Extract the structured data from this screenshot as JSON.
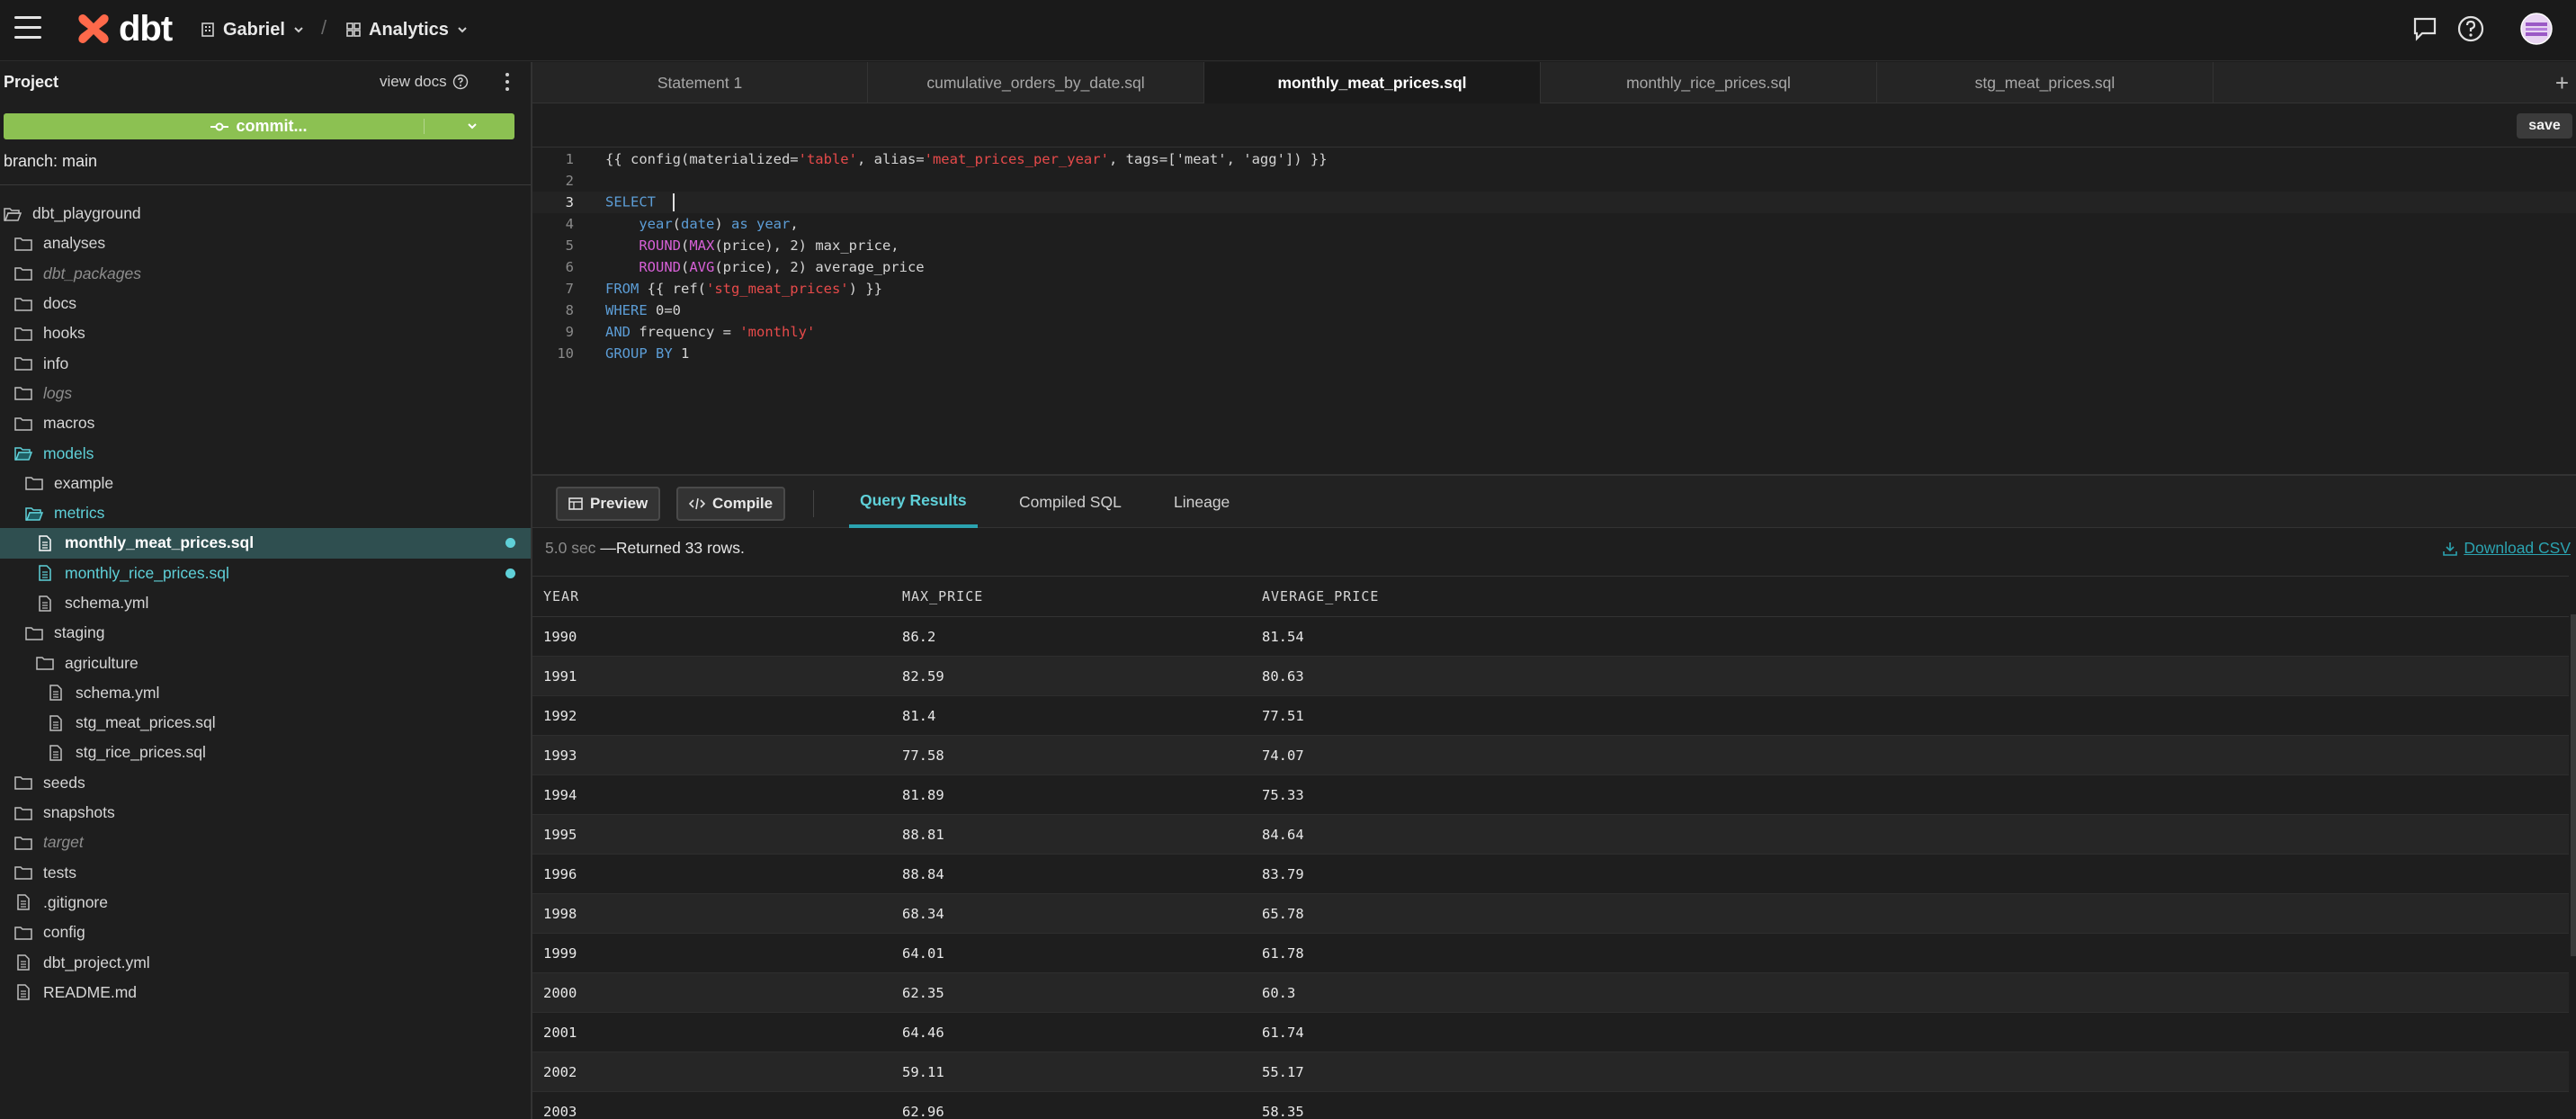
{
  "header": {
    "logo_text": "dbt",
    "org": "Gabriel",
    "separator": "/",
    "project": "Analytics"
  },
  "sidebar": {
    "title": "Project",
    "view_docs": "view docs",
    "commit_label": "commit...",
    "branch": "branch: main",
    "tree": [
      {
        "label": "dbt_playground",
        "type": "folder-open",
        "depth": 0
      },
      {
        "label": "analyses",
        "type": "folder",
        "depth": 1
      },
      {
        "label": "dbt_packages",
        "type": "folder",
        "depth": 1,
        "italic": true
      },
      {
        "label": "docs",
        "type": "folder",
        "depth": 1
      },
      {
        "label": "hooks",
        "type": "folder",
        "depth": 1
      },
      {
        "label": "info",
        "type": "folder",
        "depth": 1
      },
      {
        "label": "logs",
        "type": "folder",
        "depth": 1,
        "italic": true
      },
      {
        "label": "macros",
        "type": "folder",
        "depth": 1
      },
      {
        "label": "models",
        "type": "folder-open",
        "depth": 1,
        "teal": true
      },
      {
        "label": "example",
        "type": "folder",
        "depth": 2
      },
      {
        "label": "metrics",
        "type": "folder-open",
        "depth": 2,
        "teal": true
      },
      {
        "label": "monthly_meat_prices.sql",
        "type": "file",
        "depth": 3,
        "selected": true,
        "modified": true
      },
      {
        "label": "monthly_rice_prices.sql",
        "type": "file",
        "depth": 3,
        "teal": true,
        "modified": true
      },
      {
        "label": "schema.yml",
        "type": "file",
        "depth": 3
      },
      {
        "label": "staging",
        "type": "folder",
        "depth": 2
      },
      {
        "label": "agriculture",
        "type": "folder",
        "depth": 3
      },
      {
        "label": "schema.yml",
        "type": "file",
        "depth": 4
      },
      {
        "label": "stg_meat_prices.sql",
        "type": "file",
        "depth": 4
      },
      {
        "label": "stg_rice_prices.sql",
        "type": "file",
        "depth": 4
      },
      {
        "label": "seeds",
        "type": "folder",
        "depth": 1
      },
      {
        "label": "snapshots",
        "type": "folder",
        "depth": 1
      },
      {
        "label": "target",
        "type": "folder",
        "depth": 1,
        "italic": true
      },
      {
        "label": "tests",
        "type": "folder",
        "depth": 1
      },
      {
        "label": ".gitignore",
        "type": "file",
        "depth": 1
      },
      {
        "label": "config",
        "type": "folder",
        "depth": 1
      },
      {
        "label": "dbt_project.yml",
        "type": "file",
        "depth": 1
      },
      {
        "label": "README.md",
        "type": "file",
        "depth": 1
      }
    ]
  },
  "editor": {
    "tabs": [
      "Statement 1",
      "cumulative_orders_by_date.sql",
      "monthly_meat_prices.sql",
      "monthly_rice_prices.sql",
      "stg_meat_prices.sql"
    ],
    "active_tab": 2,
    "save_label": "save",
    "line_numbers": [
      "1",
      "2",
      "3",
      "4",
      "5",
      "6",
      "7",
      "8",
      "9",
      "10"
    ]
  },
  "results": {
    "preview_label": "Preview",
    "compile_label": "Compile",
    "tabs": [
      "Query Results",
      "Compiled SQL",
      "Lineage"
    ],
    "elapsed": "5.0 sec",
    "status": "—Returned 33 rows.",
    "download_label": "Download CSV",
    "columns": [
      "YEAR",
      "MAX_PRICE",
      "AVERAGE_PRICE"
    ],
    "rows": [
      [
        "1990",
        "86.2",
        "81.54"
      ],
      [
        "1991",
        "82.59",
        "80.63"
      ],
      [
        "1992",
        "81.4",
        "77.51"
      ],
      [
        "1993",
        "77.58",
        "74.07"
      ],
      [
        "1994",
        "81.89",
        "75.33"
      ],
      [
        "1995",
        "88.81",
        "84.64"
      ],
      [
        "1996",
        "88.84",
        "83.79"
      ],
      [
        "1998",
        "68.34",
        "65.78"
      ],
      [
        "1999",
        "64.01",
        "61.78"
      ],
      [
        "2000",
        "62.35",
        "60.3"
      ],
      [
        "2001",
        "64.46",
        "61.74"
      ],
      [
        "2002",
        "59.11",
        "55.17"
      ],
      [
        "2003",
        "62.96",
        "58.35"
      ]
    ]
  },
  "colors": {
    "accent_teal": "#5fd0d8",
    "commit_green": "#8cc152",
    "sql_keyword": "#5c9dd6",
    "sql_string": "#e64a4a",
    "sql_function": "#d660d6"
  }
}
